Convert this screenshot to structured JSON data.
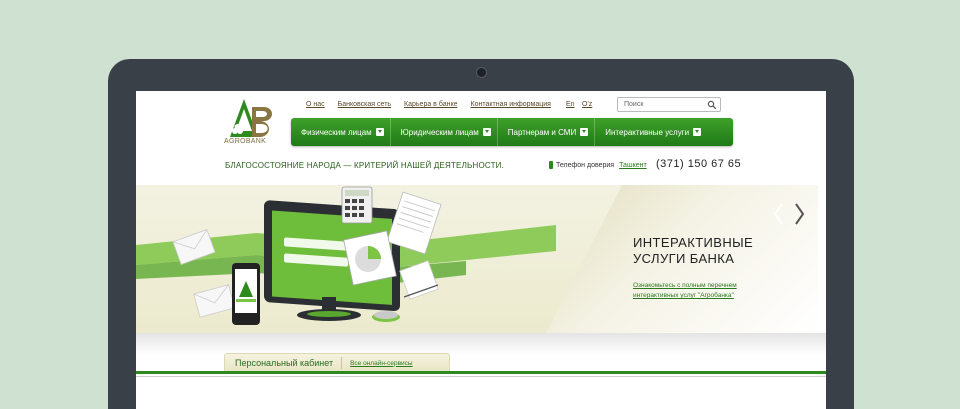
{
  "logo": {
    "text": "AGROBANK"
  },
  "toplinks": [
    "О нас",
    "Банковская сеть",
    "Карьера в банке",
    "Контактная  информация"
  ],
  "languages": [
    "En",
    "O'z"
  ],
  "search": {
    "placeholder": "Поиск"
  },
  "nav": [
    {
      "label": "Физическим лицам"
    },
    {
      "label": "Юридическим лицам"
    },
    {
      "label": "Партнерам и СМИ"
    },
    {
      "label": "Интерактивные услуги"
    }
  ],
  "tagline": "БЛАГОСОСТОЯНИЕ НАРОДА —  КРИТЕРИЙ НАШЕЙ ДЕЯТЕЛЬНОСТИ.",
  "hotline": {
    "label": "Телефон доверия",
    "city": "Ташкент",
    "number": "(371) 150 67 65"
  },
  "banner": {
    "title_line1": "ИНТЕРАКТИВНЫЕ",
    "title_line2": "УСЛУГИ БАНКА",
    "link_line1": "Ознакомьтесь с полным перечнем",
    "link_line2": "интерактивных услуг \"Агробанка\""
  },
  "cabinet": {
    "title": "Персональный кабинет",
    "link": "Все онлайн-сервисы"
  },
  "colors": {
    "brand_green": "#2e8a1e",
    "background": "#cfe1d1",
    "frame": "#3a4048"
  }
}
